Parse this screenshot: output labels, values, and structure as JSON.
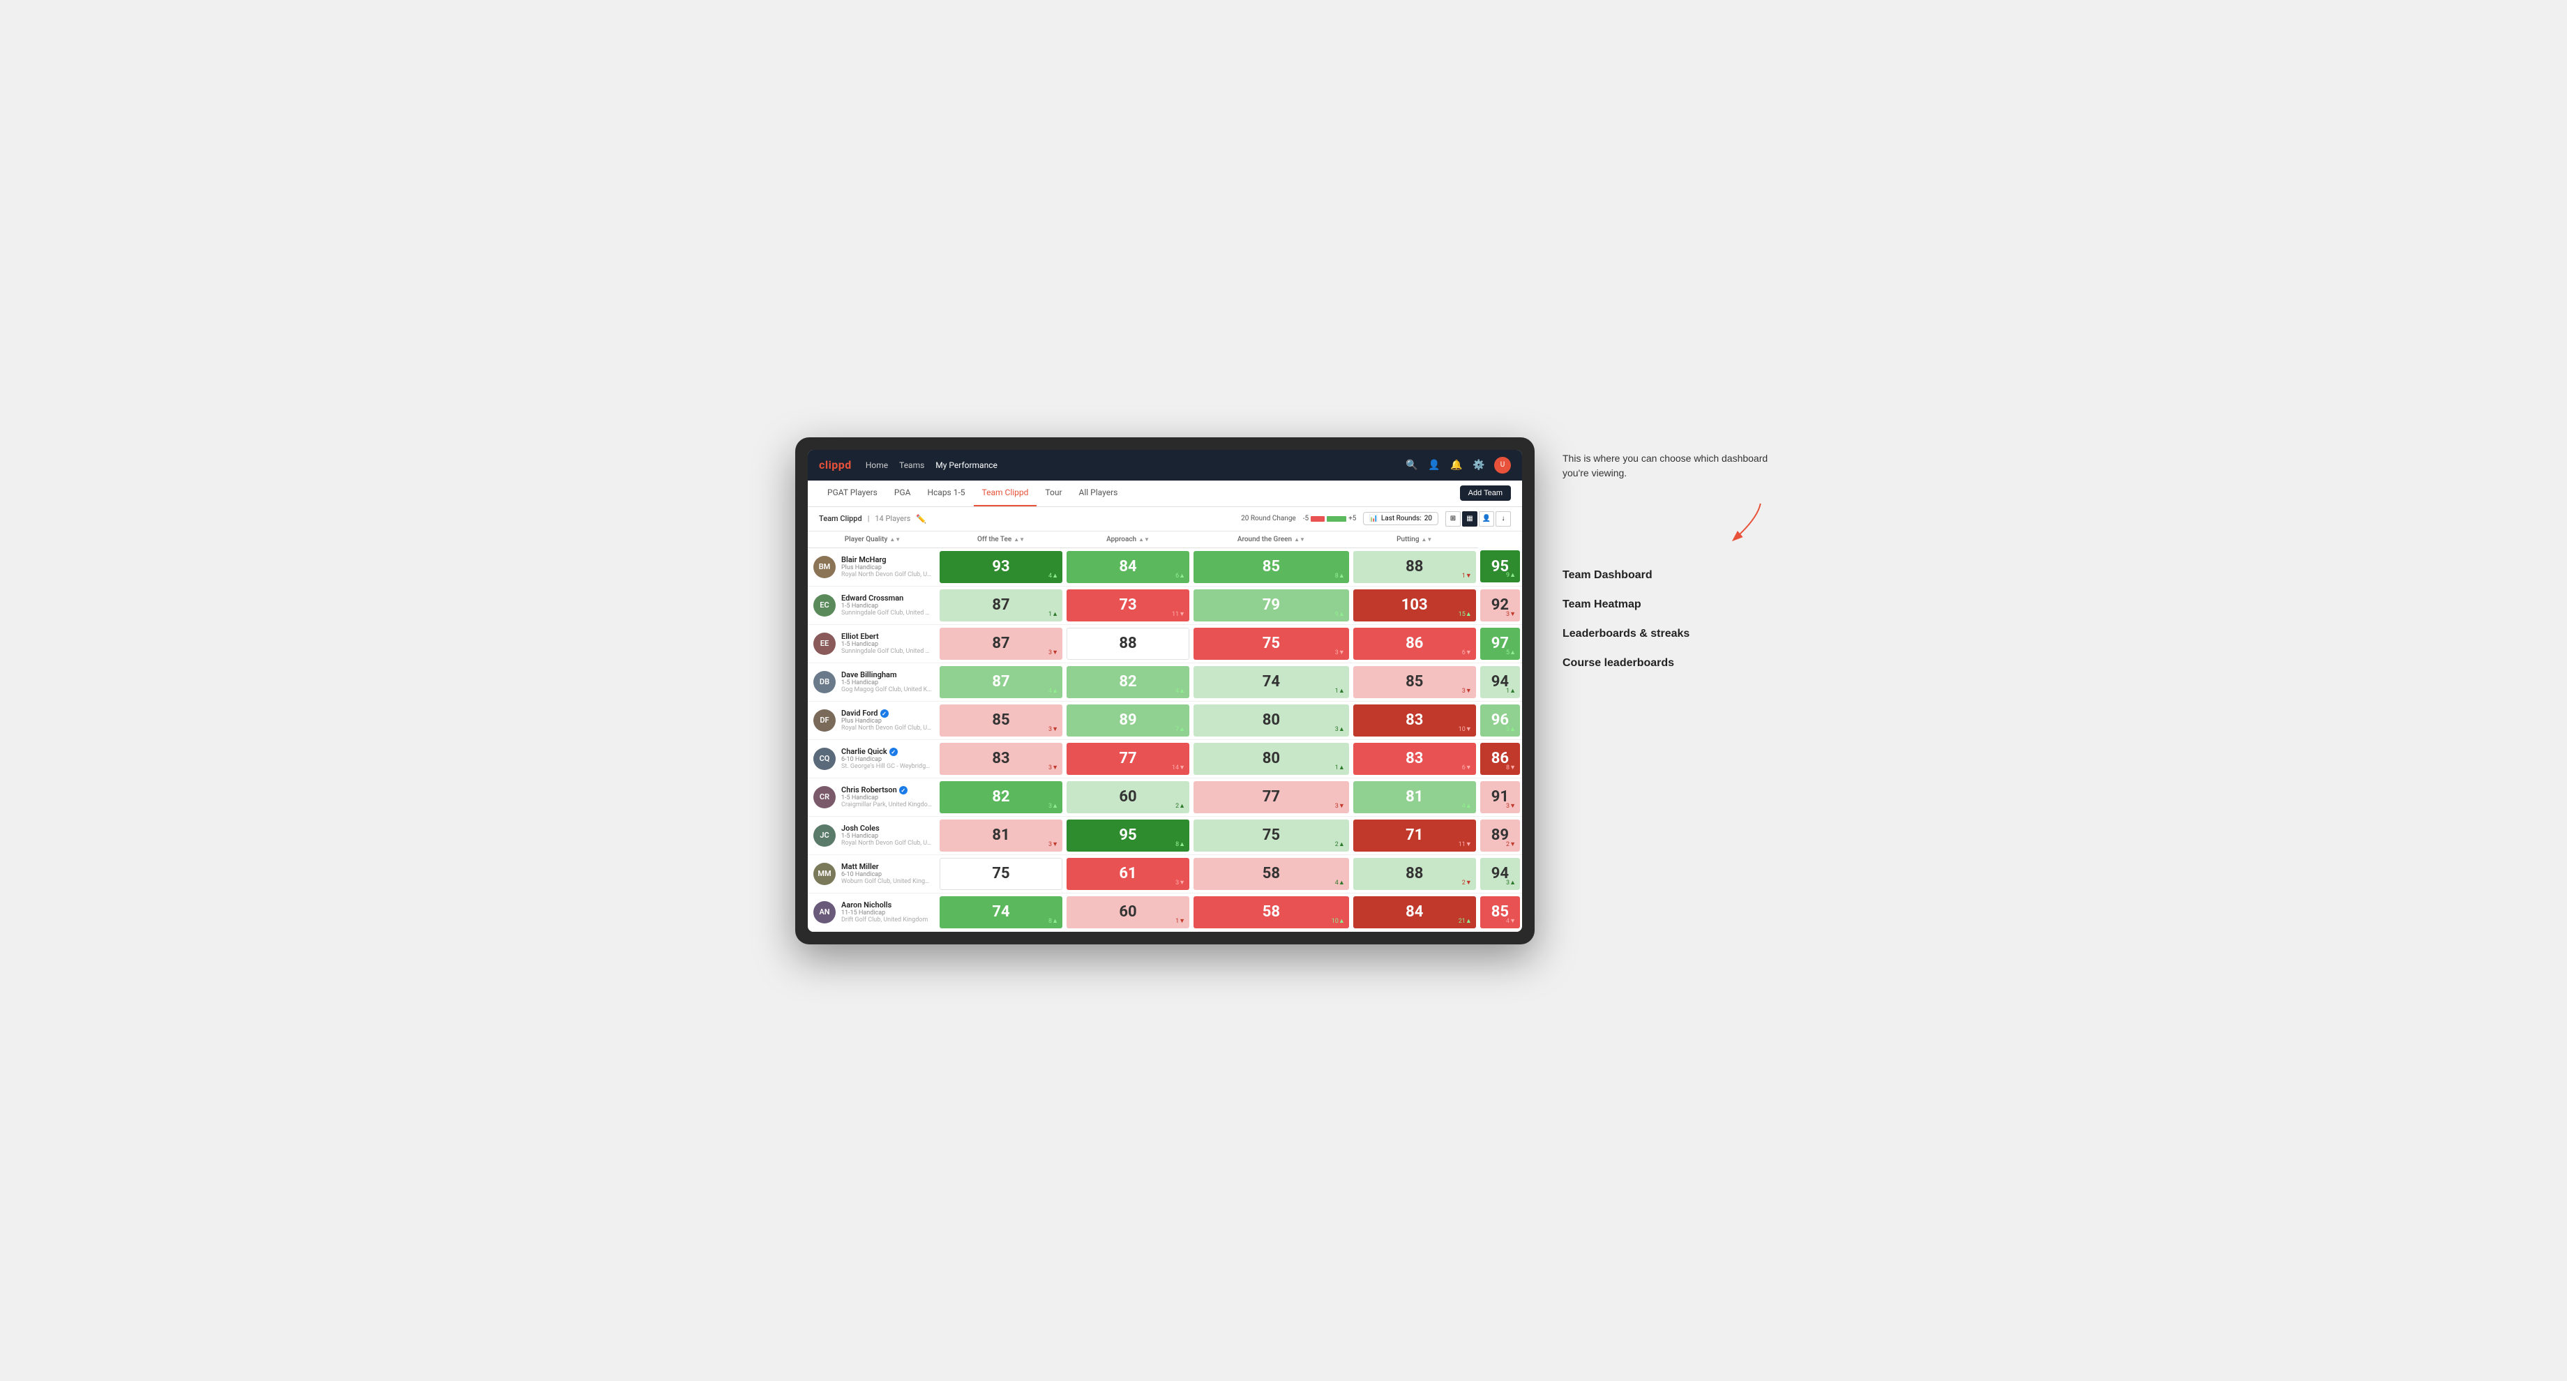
{
  "annotations": {
    "description": "This is where you can choose which dashboard you're viewing.",
    "dashboards": [
      "Team Dashboard",
      "Team Heatmap",
      "Leaderboards & streaks",
      "Course leaderboards"
    ]
  },
  "nav": {
    "logo": "clippd",
    "links": [
      "Home",
      "Teams",
      "My Performance"
    ],
    "active_link": "My Performance"
  },
  "sub_nav": {
    "links": [
      "PGAT Players",
      "PGA",
      "Hcaps 1-5",
      "Team Clippd",
      "Tour",
      "All Players"
    ],
    "active_link": "Team Clippd",
    "add_team_label": "Add Team"
  },
  "team_header": {
    "name": "Team Clippd",
    "count": "14 Players",
    "round_change_label": "20 Round Change",
    "round_change_min": "-5",
    "round_change_max": "+5",
    "last_rounds_label": "Last Rounds:",
    "last_rounds_value": "20"
  },
  "table": {
    "columns": [
      "Player Quality",
      "Off the Tee",
      "Approach",
      "Around the Green",
      "Putting"
    ],
    "players": [
      {
        "name": "Blair McHarg",
        "handicap": "Plus Handicap",
        "club": "Royal North Devon Golf Club, United Kingdom",
        "initials": "BM",
        "color": "#8B7355",
        "metrics": [
          {
            "value": 93,
            "change": 4,
            "direction": "up",
            "bg": "green-dark",
            "text": "colored"
          },
          {
            "value": 84,
            "change": 6,
            "direction": "up",
            "bg": "green-mid",
            "text": "colored"
          },
          {
            "value": 85,
            "change": 8,
            "direction": "up",
            "bg": "green-mid",
            "text": "colored"
          },
          {
            "value": 88,
            "change": 1,
            "direction": "down",
            "bg": "green-pale",
            "text": "white"
          },
          {
            "value": 95,
            "change": 9,
            "direction": "up",
            "bg": "green-dark",
            "text": "colored"
          }
        ]
      },
      {
        "name": "Edward Crossman",
        "handicap": "1-5 Handicap",
        "club": "Sunningdale Golf Club, United Kingdom",
        "initials": "EC",
        "color": "#5a8a5a",
        "metrics": [
          {
            "value": 87,
            "change": 1,
            "direction": "up",
            "bg": "green-pale",
            "text": "white"
          },
          {
            "value": 73,
            "change": 11,
            "direction": "down",
            "bg": "red-mid",
            "text": "colored"
          },
          {
            "value": 79,
            "change": 9,
            "direction": "up",
            "bg": "green-light",
            "text": "colored"
          },
          {
            "value": 103,
            "change": 15,
            "direction": "up",
            "bg": "red-dark",
            "text": "colored"
          },
          {
            "value": 92,
            "change": 3,
            "direction": "down",
            "bg": "red-pale",
            "text": "white"
          }
        ]
      },
      {
        "name": "Elliot Ebert",
        "handicap": "1-5 Handicap",
        "club": "Sunningdale Golf Club, United Kingdom",
        "initials": "EE",
        "color": "#8a5a5a",
        "metrics": [
          {
            "value": 87,
            "change": 3,
            "direction": "down",
            "bg": "red-pale",
            "text": "white"
          },
          {
            "value": 88,
            "change": null,
            "direction": "none",
            "bg": "white",
            "text": "white"
          },
          {
            "value": 75,
            "change": 3,
            "direction": "down",
            "bg": "red-mid",
            "text": "colored"
          },
          {
            "value": 86,
            "change": 6,
            "direction": "down",
            "bg": "red-mid",
            "text": "colored"
          },
          {
            "value": 97,
            "change": 5,
            "direction": "up",
            "bg": "green-mid",
            "text": "colored"
          }
        ]
      },
      {
        "name": "Dave Billingham",
        "handicap": "1-5 Handicap",
        "club": "Gog Magog Golf Club, United Kingdom",
        "initials": "DB",
        "color": "#6a7a8a",
        "metrics": [
          {
            "value": 87,
            "change": 4,
            "direction": "up",
            "bg": "green-light",
            "text": "colored"
          },
          {
            "value": 82,
            "change": 4,
            "direction": "up",
            "bg": "green-light",
            "text": "colored"
          },
          {
            "value": 74,
            "change": 1,
            "direction": "up",
            "bg": "green-pale",
            "text": "white"
          },
          {
            "value": 85,
            "change": 3,
            "direction": "down",
            "bg": "red-pale",
            "text": "white"
          },
          {
            "value": 94,
            "change": 1,
            "direction": "up",
            "bg": "green-pale",
            "text": "white"
          }
        ]
      },
      {
        "name": "David Ford",
        "handicap": "Plus Handicap",
        "club": "Royal North Devon Golf Club, United Kingdom",
        "initials": "DF",
        "color": "#7a6a5a",
        "verified": true,
        "metrics": [
          {
            "value": 85,
            "change": 3,
            "direction": "down",
            "bg": "red-pale",
            "text": "white"
          },
          {
            "value": 89,
            "change": 7,
            "direction": "up",
            "bg": "green-light",
            "text": "colored"
          },
          {
            "value": 80,
            "change": 3,
            "direction": "up",
            "bg": "green-pale",
            "text": "white"
          },
          {
            "value": 83,
            "change": 10,
            "direction": "down",
            "bg": "red-dark",
            "text": "colored"
          },
          {
            "value": 96,
            "change": 3,
            "direction": "up",
            "bg": "green-light",
            "text": "colored"
          }
        ]
      },
      {
        "name": "Charlie Quick",
        "handicap": "6-10 Handicap",
        "club": "St. George's Hill GC - Weybridge - Surrey, Uni...",
        "initials": "CQ",
        "color": "#5a6a7a",
        "verified": true,
        "metrics": [
          {
            "value": 83,
            "change": 3,
            "direction": "down",
            "bg": "red-pale",
            "text": "white"
          },
          {
            "value": 77,
            "change": 14,
            "direction": "down",
            "bg": "red-mid",
            "text": "colored"
          },
          {
            "value": 80,
            "change": 1,
            "direction": "up",
            "bg": "green-pale",
            "text": "white"
          },
          {
            "value": 83,
            "change": 6,
            "direction": "down",
            "bg": "red-mid",
            "text": "colored"
          },
          {
            "value": 86,
            "change": 8,
            "direction": "down",
            "bg": "red-dark",
            "text": "colored"
          }
        ]
      },
      {
        "name": "Chris Robertson",
        "handicap": "1-5 Handicap",
        "club": "Craigmillar Park, United Kingdom",
        "initials": "CR",
        "color": "#7a5a6a",
        "verified": true,
        "metrics": [
          {
            "value": 82,
            "change": 3,
            "direction": "up",
            "bg": "green-mid",
            "text": "colored"
          },
          {
            "value": 60,
            "change": 2,
            "direction": "up",
            "bg": "green-pale",
            "text": "white"
          },
          {
            "value": 77,
            "change": 3,
            "direction": "down",
            "bg": "red-pale",
            "text": "white"
          },
          {
            "value": 81,
            "change": 4,
            "direction": "up",
            "bg": "green-light",
            "text": "colored"
          },
          {
            "value": 91,
            "change": 3,
            "direction": "down",
            "bg": "red-pale",
            "text": "white"
          }
        ]
      },
      {
        "name": "Josh Coles",
        "handicap": "1-5 Handicap",
        "club": "Royal North Devon Golf Club, United Kingdom",
        "initials": "JC",
        "color": "#5a7a6a",
        "metrics": [
          {
            "value": 81,
            "change": 3,
            "direction": "down",
            "bg": "red-pale",
            "text": "white"
          },
          {
            "value": 95,
            "change": 8,
            "direction": "up",
            "bg": "green-dark",
            "text": "colored"
          },
          {
            "value": 75,
            "change": 2,
            "direction": "up",
            "bg": "green-pale",
            "text": "white"
          },
          {
            "value": 71,
            "change": 11,
            "direction": "down",
            "bg": "red-dark",
            "text": "colored"
          },
          {
            "value": 89,
            "change": 2,
            "direction": "down",
            "bg": "red-pale",
            "text": "white"
          }
        ]
      },
      {
        "name": "Matt Miller",
        "handicap": "6-10 Handicap",
        "club": "Woburn Golf Club, United Kingdom",
        "initials": "MM",
        "color": "#7a7a5a",
        "metrics": [
          {
            "value": 75,
            "change": null,
            "direction": "none",
            "bg": "white",
            "text": "white"
          },
          {
            "value": 61,
            "change": 3,
            "direction": "down",
            "bg": "red-mid",
            "text": "colored"
          },
          {
            "value": 58,
            "change": 4,
            "direction": "up",
            "bg": "red-pale",
            "text": "white"
          },
          {
            "value": 88,
            "change": 2,
            "direction": "down",
            "bg": "green-pale",
            "text": "white"
          },
          {
            "value": 94,
            "change": 3,
            "direction": "up",
            "bg": "green-pale",
            "text": "white"
          }
        ]
      },
      {
        "name": "Aaron Nicholls",
        "handicap": "11-15 Handicap",
        "club": "Drift Golf Club, United Kingdom",
        "initials": "AN",
        "color": "#6a5a7a",
        "metrics": [
          {
            "value": 74,
            "change": 8,
            "direction": "up",
            "bg": "green-mid",
            "text": "colored"
          },
          {
            "value": 60,
            "change": 1,
            "direction": "down",
            "bg": "red-pale",
            "text": "white"
          },
          {
            "value": 58,
            "change": 10,
            "direction": "up",
            "bg": "red-mid",
            "text": "colored"
          },
          {
            "value": 84,
            "change": 21,
            "direction": "up",
            "bg": "red-dark",
            "text": "colored"
          },
          {
            "value": 85,
            "change": 4,
            "direction": "down",
            "bg": "red-mid",
            "text": "colored"
          }
        ]
      }
    ]
  }
}
